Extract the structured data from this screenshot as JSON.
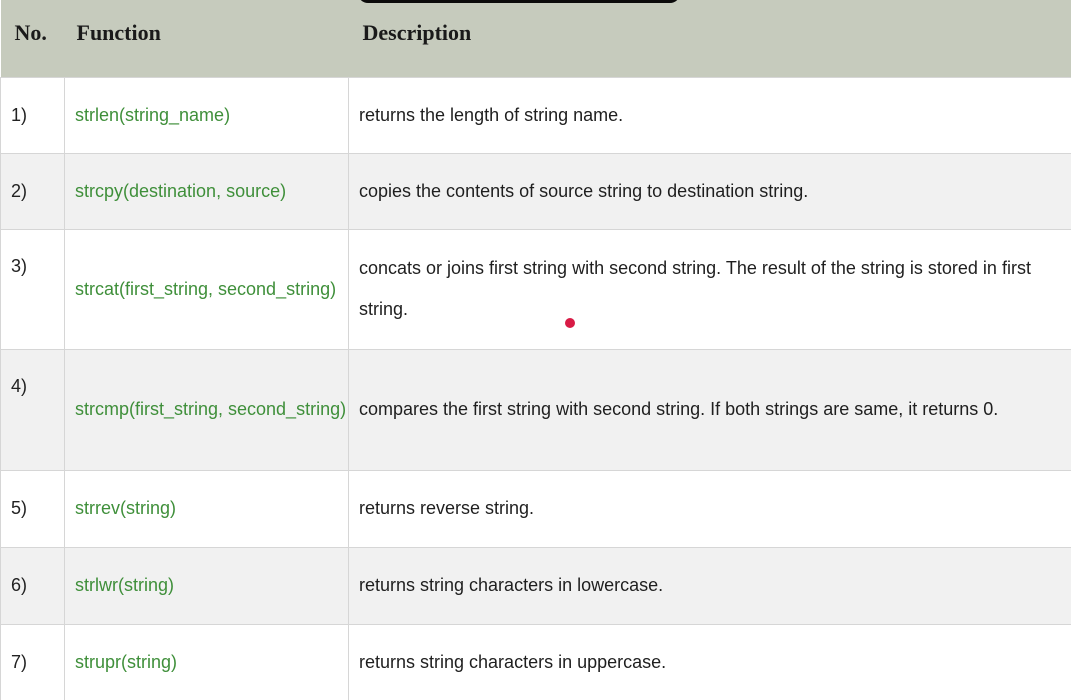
{
  "table": {
    "headers": {
      "no": "No.",
      "function": "Function",
      "description": "Description"
    },
    "rows": [
      {
        "no": "1)",
        "function": "strlen(string_name)",
        "description": "returns the length of string name."
      },
      {
        "no": "2)",
        "function": "strcpy(destination, source)",
        "description": "copies the contents of source string to destination string."
      },
      {
        "no": "3)",
        "function": "strcat(first_string, second_string)",
        "description": "concats or joins first string with second string. The result of the string is stored in first string."
      },
      {
        "no": "4)",
        "function": "strcmp(first_string, second_string)",
        "description": "compares the first string with second string. If both strings are same, it returns 0."
      },
      {
        "no": "5)",
        "function": "strrev(string)",
        "description": "returns reverse string."
      },
      {
        "no": "6)",
        "function": "strlwr(string)",
        "description": "returns string characters in lowercase."
      },
      {
        "no": "7)",
        "function": "strupr(string)",
        "description": "returns string characters in uppercase."
      }
    ]
  },
  "colors": {
    "header_bg": "#c6cbbd",
    "function_text": "#3f8f3a",
    "even_row_bg": "#f1f1f1",
    "cursor_dot": "#d81b45"
  }
}
